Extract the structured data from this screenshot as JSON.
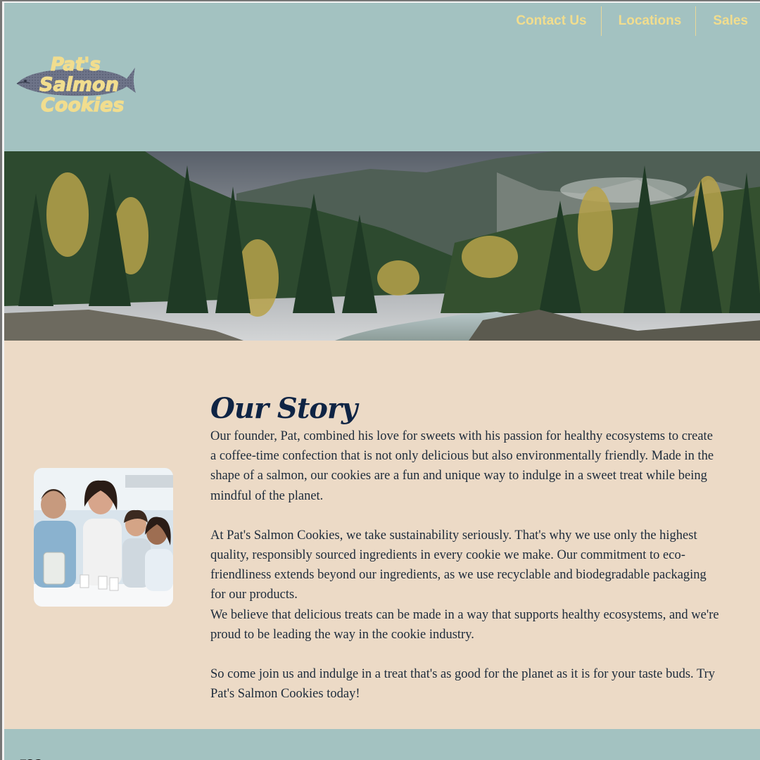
{
  "nav": {
    "items": [
      {
        "label": "Contact Us"
      },
      {
        "label": "Locations"
      },
      {
        "label": "Sales"
      }
    ]
  },
  "logo": {
    "line1": "Pat's",
    "line2": "Salmon",
    "line3": "Cookies",
    "icon": "salmon-icon"
  },
  "hero": {
    "image": "forest-river-mountain-photo"
  },
  "story": {
    "title": "Our Story",
    "paragraph1": "Our founder, Pat, combined his love for sweets with his passion for healthy ecosystems to create a coffee-time confection that is not only delicious but also environmentally friendly. Made in the shape of a salmon, our cookies are a fun and unique way to indulge in a sweet treat while being mindful of the planet.",
    "paragraph2": "At Pat's Salmon Cookies, we take sustainability seriously. That's why we use only the highest quality, responsibly sourced ingredients in every cookie we make. Our commitment to eco-friendliness extends beyond our ingredients, as we use recyclable and biodegradable packaging for our products.",
    "paragraph3": "We believe that delicious treats can be made in a way that supports healthy ecosystems, and we're proud to be leading the way in the cookie industry.",
    "paragraph4": "So come join us and indulge in a treat that's as good for the planet as it is for your taste buds. Try Pat's Salmon Cookies today!",
    "photo": "family-photo"
  },
  "footer": {
    "mark": "m"
  },
  "colors": {
    "header_bg": "#a3c2c1",
    "nav_text": "#f1dd8e",
    "story_bg": "#ecdac6",
    "title": "#0f2444"
  }
}
